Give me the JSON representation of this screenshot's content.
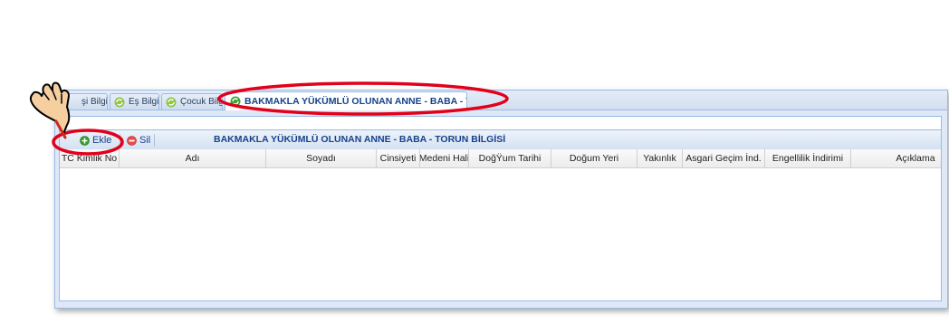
{
  "tabs": [
    {
      "label": "Eşi Bilgisi",
      "visible_label": "şi Bilgisi",
      "active": false
    },
    {
      "label": "Eş Bilgisi",
      "active": false
    },
    {
      "label": "Çocuk Bilgisi",
      "active": false
    },
    {
      "label": "BAKMAKLA YÜKÜMLÜ OLUNAN ANNE - BABA - TORUN BİLGİSİ",
      "active": true
    }
  ],
  "toolbar": {
    "add_label": "Ekle",
    "delete_label": "Sil",
    "title": "BAKMAKLA YÜKÜMLÜ OLUNAN ANNE - BABA - TORUN BİLGİSİ"
  },
  "grid": {
    "columns": [
      "TC Kimlik No",
      "Adı",
      "Soyadı",
      "Cinsiyeti",
      "Medeni Hali",
      "DoğŸum Tarihi",
      "Doğum Yeri",
      "Yakınlık",
      "Asgari Geçim İnd.",
      "Engellilik İndirimi",
      "Açıklama"
    ],
    "rows": []
  },
  "colors": {
    "panel_border": "#99bbe8",
    "header_text": "#15428b",
    "annotation_red": "#e2001a",
    "add_icon": "#2e9e2e",
    "delete_icon": "#d9363e",
    "tab_icon": "#3aa33a"
  },
  "icons": {
    "tab": "refresh-tab-icon",
    "add": "add-circle-icon",
    "delete": "delete-circle-icon",
    "pointer": "hand-pointer-icon"
  }
}
